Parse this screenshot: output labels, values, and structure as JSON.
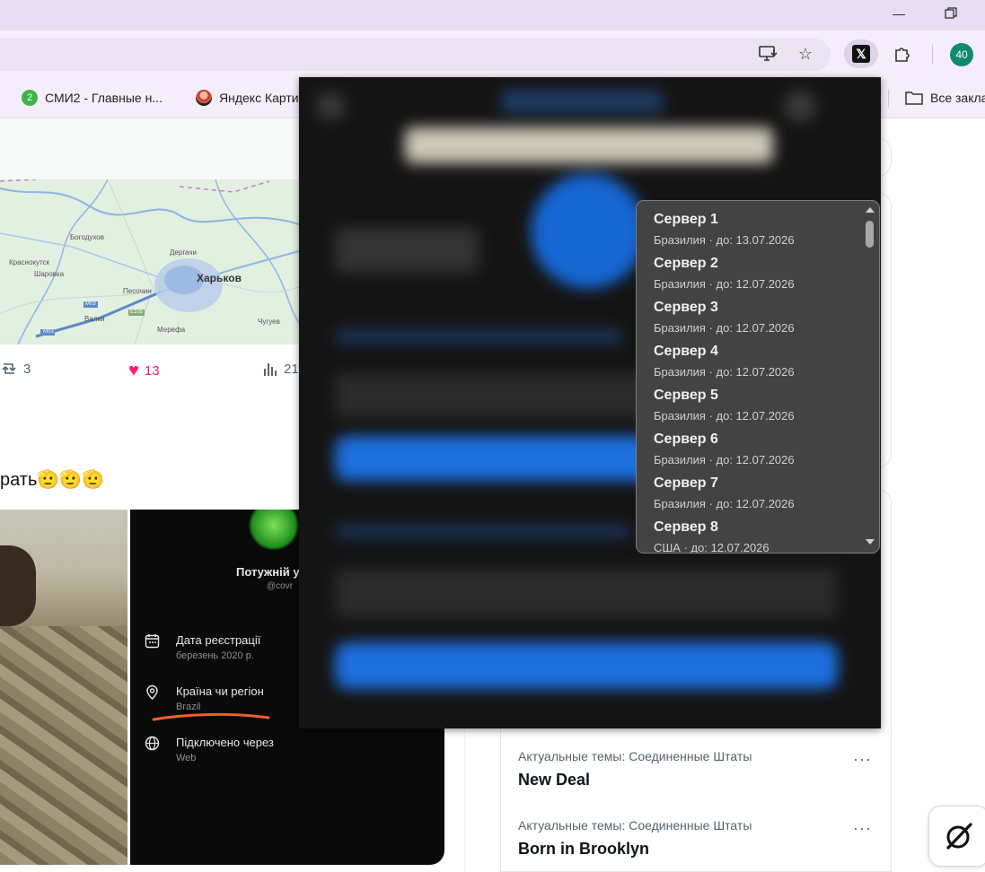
{
  "browser": {
    "extension_badge": "40",
    "bookmarks": [
      {
        "badge": "2",
        "label": "СМИ2 - Главные н..."
      },
      {
        "label": "Яндекс Карти"
      },
      {
        "label": "Все закла"
      }
    ]
  },
  "feed": {
    "map": {
      "city_main": "Харьков",
      "places": [
        "Богодухов",
        "Краснокутск",
        "Шарoвка",
        "Дергачи",
        "Песочин",
        "Валки",
        "Мерефа",
        "Чугуев"
      ],
      "roads": [
        "M03",
        "E105",
        "M03"
      ]
    },
    "stats": {
      "retweets": "3",
      "likes": "13",
      "views": "21"
    },
    "tweet_text": "рать🫡🫡🫡",
    "profile_card": {
      "name": "Потужній у",
      "handle": "@covr",
      "rows": [
        {
          "label": "Дата реєстрації",
          "value": "березень 2020 р."
        },
        {
          "label": "Країна чи регіон",
          "value": "Brazil"
        },
        {
          "label": "Підключено через",
          "value": "Web"
        }
      ]
    }
  },
  "trends": [
    {
      "category": "Актуальные темы: Соединенные Штаты",
      "name": "New Deal",
      "more": "···"
    },
    {
      "category": "Актуальные темы: Соединенные Штаты",
      "name": "Born in Brooklyn",
      "more": "···"
    }
  ],
  "popup": {
    "server_list": [
      {
        "name": "Сервер 1",
        "detail": "Бразилия · до: 13.07.2026"
      },
      {
        "name": "Сервер 2",
        "detail": "Бразилия · до: 12.07.2026"
      },
      {
        "name": "Сервер 3",
        "detail": "Бразилия · до: 12.07.2026"
      },
      {
        "name": "Сервер 4",
        "detail": "Бразилия · до: 12.07.2026"
      },
      {
        "name": "Сервер 5",
        "detail": "Бразилия · до: 12.07.2026"
      },
      {
        "name": "Сервер 6",
        "detail": "Бразилия · до: 12.07.2026"
      },
      {
        "name": "Сервер 7",
        "detail": "Бразилия · до: 12.07.2026"
      },
      {
        "name": "Сервер 8",
        "detail": "США · до: 12.07.2026"
      }
    ]
  },
  "colors": {
    "chrome_bg": "#f5eefa",
    "like": "#f91880",
    "popup_bg": "#141414",
    "dropdown_bg": "#434343",
    "accent_blue": "#1d6fe0"
  }
}
